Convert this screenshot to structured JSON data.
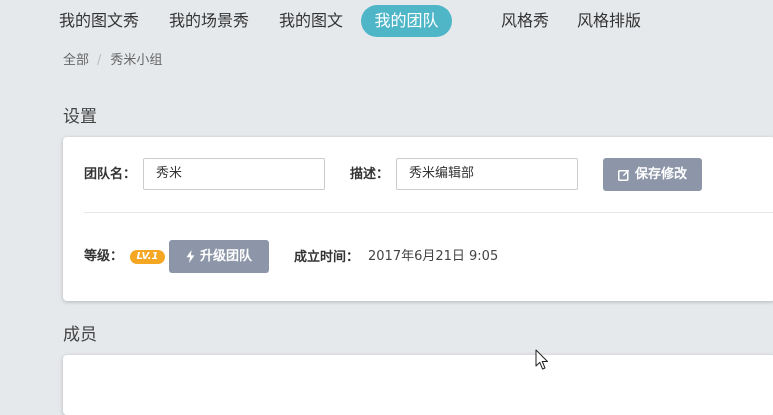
{
  "nav": {
    "items": [
      {
        "label": "我的图文秀"
      },
      {
        "label": "我的场景秀"
      },
      {
        "label": "我的图文"
      },
      {
        "label": "我的团队",
        "active": true
      },
      {
        "label": "风格秀"
      },
      {
        "label": "风格排版"
      }
    ]
  },
  "breadcrumb": {
    "root": "全部",
    "separator": "/",
    "current": "秀米小组"
  },
  "settings": {
    "title": "设置",
    "team_name_label": "团队名：",
    "team_name_value": "秀米",
    "description_label": "描述：",
    "description_value": "秀米编辑部",
    "save_button": "保存修改",
    "level_label": "等级：",
    "level_badge": "LV.1",
    "upgrade_button": "升级团队",
    "founded_label": "成立时间：",
    "founded_value": "2017年6月21日 9:05"
  },
  "members": {
    "title": "成员"
  },
  "colors": {
    "page_background": "#e6e9ec",
    "active_tab": "#4fb6c8",
    "button_gray": "#8c96a8",
    "level_badge": "#f5a623"
  },
  "icons": {
    "save": "edit-icon",
    "upgrade": "lightning-bolt-icon",
    "cursor": "mouse-pointer-icon"
  }
}
